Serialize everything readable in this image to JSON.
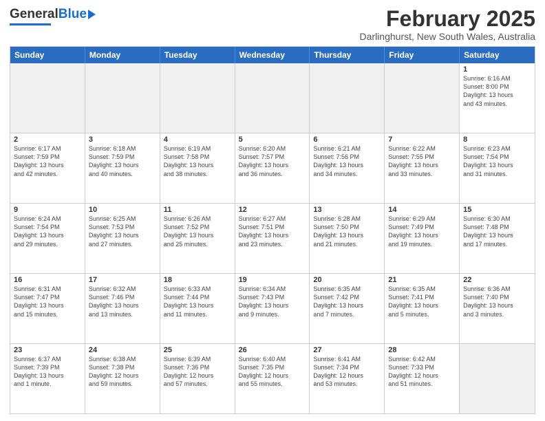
{
  "header": {
    "logo_general": "General",
    "logo_blue": "Blue",
    "title": "February 2025",
    "subtitle": "Darlinghurst, New South Wales, Australia"
  },
  "days_of_week": [
    "Sunday",
    "Monday",
    "Tuesday",
    "Wednesday",
    "Thursday",
    "Friday",
    "Saturday"
  ],
  "weeks": [
    [
      {
        "day": "",
        "text": "",
        "shaded": true
      },
      {
        "day": "",
        "text": "",
        "shaded": true
      },
      {
        "day": "",
        "text": "",
        "shaded": true
      },
      {
        "day": "",
        "text": "",
        "shaded": true
      },
      {
        "day": "",
        "text": "",
        "shaded": true
      },
      {
        "day": "",
        "text": "",
        "shaded": true
      },
      {
        "day": "1",
        "text": "Sunrise: 6:16 AM\nSunset: 8:00 PM\nDaylight: 13 hours\nand 43 minutes."
      }
    ],
    [
      {
        "day": "2",
        "text": "Sunrise: 6:17 AM\nSunset: 7:59 PM\nDaylight: 13 hours\nand 42 minutes."
      },
      {
        "day": "3",
        "text": "Sunrise: 6:18 AM\nSunset: 7:59 PM\nDaylight: 13 hours\nand 40 minutes."
      },
      {
        "day": "4",
        "text": "Sunrise: 6:19 AM\nSunset: 7:58 PM\nDaylight: 13 hours\nand 38 minutes."
      },
      {
        "day": "5",
        "text": "Sunrise: 6:20 AM\nSunset: 7:57 PM\nDaylight: 13 hours\nand 36 minutes."
      },
      {
        "day": "6",
        "text": "Sunrise: 6:21 AM\nSunset: 7:56 PM\nDaylight: 13 hours\nand 34 minutes."
      },
      {
        "day": "7",
        "text": "Sunrise: 6:22 AM\nSunset: 7:55 PM\nDaylight: 13 hours\nand 33 minutes."
      },
      {
        "day": "8",
        "text": "Sunrise: 6:23 AM\nSunset: 7:54 PM\nDaylight: 13 hours\nand 31 minutes."
      }
    ],
    [
      {
        "day": "9",
        "text": "Sunrise: 6:24 AM\nSunset: 7:54 PM\nDaylight: 13 hours\nand 29 minutes."
      },
      {
        "day": "10",
        "text": "Sunrise: 6:25 AM\nSunset: 7:53 PM\nDaylight: 13 hours\nand 27 minutes."
      },
      {
        "day": "11",
        "text": "Sunrise: 6:26 AM\nSunset: 7:52 PM\nDaylight: 13 hours\nand 25 minutes."
      },
      {
        "day": "12",
        "text": "Sunrise: 6:27 AM\nSunset: 7:51 PM\nDaylight: 13 hours\nand 23 minutes."
      },
      {
        "day": "13",
        "text": "Sunrise: 6:28 AM\nSunset: 7:50 PM\nDaylight: 13 hours\nand 21 minutes."
      },
      {
        "day": "14",
        "text": "Sunrise: 6:29 AM\nSunset: 7:49 PM\nDaylight: 13 hours\nand 19 minutes."
      },
      {
        "day": "15",
        "text": "Sunrise: 6:30 AM\nSunset: 7:48 PM\nDaylight: 13 hours\nand 17 minutes."
      }
    ],
    [
      {
        "day": "16",
        "text": "Sunrise: 6:31 AM\nSunset: 7:47 PM\nDaylight: 13 hours\nand 15 minutes."
      },
      {
        "day": "17",
        "text": "Sunrise: 6:32 AM\nSunset: 7:46 PM\nDaylight: 13 hours\nand 13 minutes."
      },
      {
        "day": "18",
        "text": "Sunrise: 6:33 AM\nSunset: 7:44 PM\nDaylight: 13 hours\nand 11 minutes."
      },
      {
        "day": "19",
        "text": "Sunrise: 6:34 AM\nSunset: 7:43 PM\nDaylight: 13 hours\nand 9 minutes."
      },
      {
        "day": "20",
        "text": "Sunrise: 6:35 AM\nSunset: 7:42 PM\nDaylight: 13 hours\nand 7 minutes."
      },
      {
        "day": "21",
        "text": "Sunrise: 6:35 AM\nSunset: 7:41 PM\nDaylight: 13 hours\nand 5 minutes."
      },
      {
        "day": "22",
        "text": "Sunrise: 6:36 AM\nSunset: 7:40 PM\nDaylight: 13 hours\nand 3 minutes."
      }
    ],
    [
      {
        "day": "23",
        "text": "Sunrise: 6:37 AM\nSunset: 7:39 PM\nDaylight: 13 hours\nand 1 minute."
      },
      {
        "day": "24",
        "text": "Sunrise: 6:38 AM\nSunset: 7:38 PM\nDaylight: 12 hours\nand 59 minutes."
      },
      {
        "day": "25",
        "text": "Sunrise: 6:39 AM\nSunset: 7:36 PM\nDaylight: 12 hours\nand 57 minutes."
      },
      {
        "day": "26",
        "text": "Sunrise: 6:40 AM\nSunset: 7:35 PM\nDaylight: 12 hours\nand 55 minutes."
      },
      {
        "day": "27",
        "text": "Sunrise: 6:41 AM\nSunset: 7:34 PM\nDaylight: 12 hours\nand 53 minutes."
      },
      {
        "day": "28",
        "text": "Sunrise: 6:42 AM\nSunset: 7:33 PM\nDaylight: 12 hours\nand 51 minutes."
      },
      {
        "day": "",
        "text": "",
        "shaded": true
      }
    ]
  ]
}
